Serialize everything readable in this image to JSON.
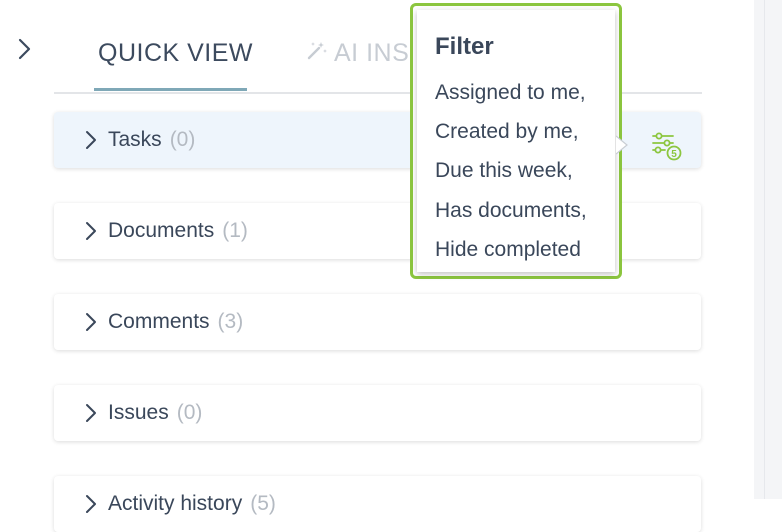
{
  "tabs": [
    {
      "label": "QUICK VIEW"
    },
    {
      "label": "AI INS"
    }
  ],
  "sections": [
    {
      "label": "Tasks",
      "count": "(0)"
    },
    {
      "label": "Documents",
      "count": "(1)"
    },
    {
      "label": "Comments",
      "count": "(3)"
    },
    {
      "label": "Issues",
      "count": "(0)"
    },
    {
      "label": "Activity history",
      "count": "(5)"
    }
  ],
  "filter": {
    "badge": "5",
    "tooltip_title": "Filter",
    "tooltip_lines": [
      "Assigned to me,",
      "Created by me,",
      "Due this week,",
      "Has documents,",
      "Hide completed"
    ]
  },
  "colors": {
    "accent_green": "#8cc63f",
    "active_row": "#eef5fc",
    "tab_underline": "#7fa8b7"
  }
}
